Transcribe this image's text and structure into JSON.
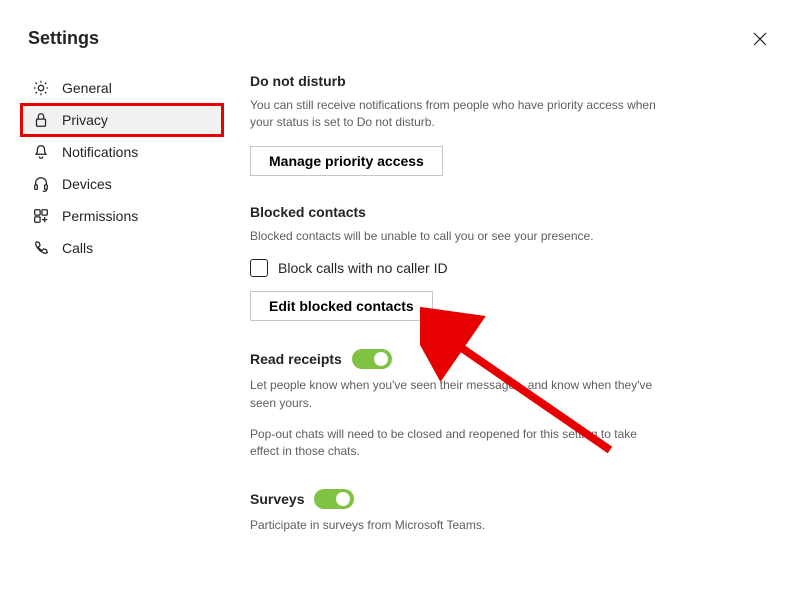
{
  "header": {
    "title": "Settings"
  },
  "sidebar": {
    "general": "General",
    "privacy": "Privacy",
    "notifications": "Notifications",
    "devices": "Devices",
    "permissions": "Permissions",
    "calls": "Calls"
  },
  "dnd": {
    "title": "Do not disturb",
    "desc": "You can still receive notifications from people who have priority access when your status is set to Do not disturb.",
    "button": "Manage priority access"
  },
  "blocked": {
    "title": "Blocked contacts",
    "desc": "Blocked contacts will be unable to call you or see your presence.",
    "checkbox_label": "Block calls with no caller ID",
    "button": "Edit blocked contacts"
  },
  "read_receipts": {
    "title": "Read receipts",
    "desc1": "Let people know when you've seen their messages, and know when they've seen yours.",
    "desc2": "Pop-out chats will need to be closed and reopened for this setting to take effect in those chats."
  },
  "surveys": {
    "title": "Surveys",
    "desc": "Participate in surveys from Microsoft Teams."
  }
}
